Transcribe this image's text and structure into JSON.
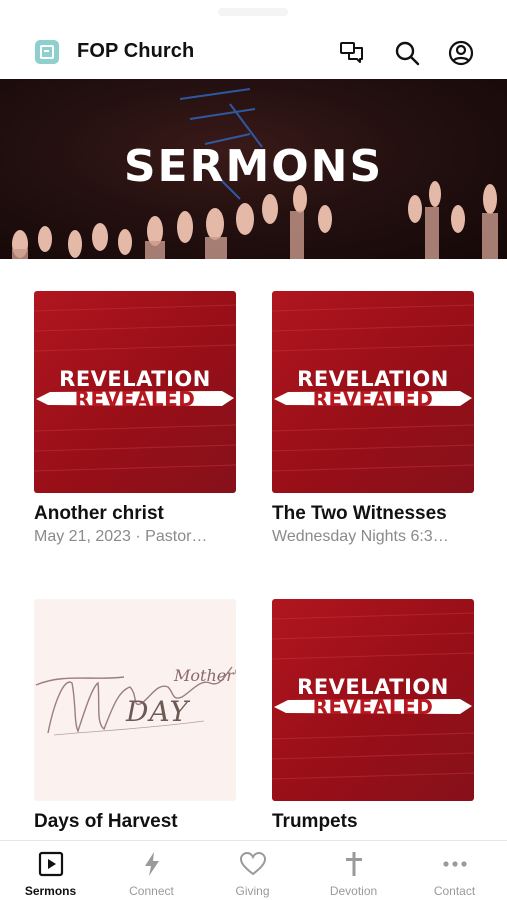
{
  "header": {
    "app_title": "FOP Church",
    "icons": [
      "logo-icon",
      "chat-icon",
      "search-icon",
      "account-icon"
    ]
  },
  "banner": {
    "title": "SERMONS"
  },
  "sermons": [
    {
      "art_top": "REVELATION",
      "art_bottom": "REVEALED",
      "title": "Another christ",
      "subtitle": "May 21, 2023 · Pastor…"
    },
    {
      "art_top": "REVELATION",
      "art_bottom": "REVEALED",
      "title": "The Two Witnesses",
      "subtitle": "Wednesday Nights 6:3…"
    },
    {
      "art_script": "Mother's",
      "art_day": "DAY",
      "title": "Days of Harvest",
      "subtitle": ""
    },
    {
      "art_top": "REVELATION",
      "art_bottom": "REVEALED",
      "title": "Trumpets",
      "subtitle": ""
    }
  ],
  "tabs": [
    {
      "label": "Sermons",
      "icon": "play-icon",
      "active": true
    },
    {
      "label": "Connect",
      "icon": "lightning-icon",
      "active": false
    },
    {
      "label": "Giving",
      "icon": "heart-icon",
      "active": false
    },
    {
      "label": "Devotion",
      "icon": "cross-icon",
      "active": false
    },
    {
      "label": "Contact",
      "icon": "more-icon",
      "active": false
    }
  ],
  "colors": {
    "accent_red": "#b0161f",
    "logo_teal": "#8fd0cf",
    "tab_inactive": "#9a9a9a"
  }
}
